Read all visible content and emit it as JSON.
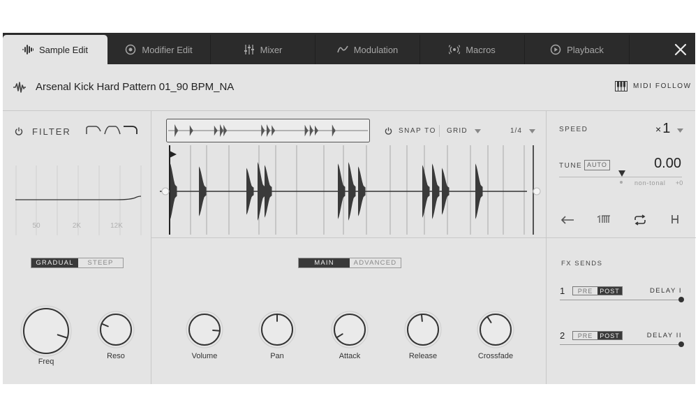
{
  "tabs": [
    {
      "label": "Sample Edit",
      "icon": "waveform-icon",
      "active": true
    },
    {
      "label": "Modifier Edit",
      "icon": "target-icon",
      "active": false
    },
    {
      "label": "Mixer",
      "icon": "mixer-faders-icon",
      "active": false
    },
    {
      "label": "Modulation",
      "icon": "wave-curve-icon",
      "active": false
    },
    {
      "label": "Macros",
      "icon": "broadcast-icon",
      "active": false
    },
    {
      "label": "Playback",
      "icon": "play-circle-icon",
      "active": false
    }
  ],
  "header": {
    "sample_name": "Arsenal Kick Hard Pattern 01_90 BPM_NA",
    "midi_follow": "MIDI FOLLOW"
  },
  "filter": {
    "title": "FILTER",
    "freq_ticks": [
      "50",
      "2K",
      "12K"
    ],
    "modes": [
      "GRADUAL",
      "STEEP"
    ],
    "mode_selected": "GRADUAL",
    "knobs": [
      {
        "label": "Freq",
        "value": 0.9
      },
      {
        "label": "Reso",
        "value": 0.25
      }
    ]
  },
  "waveform": {
    "snap_label": "SNAP TO",
    "grid_label": "GRID",
    "division": "1/4",
    "tabs": [
      "MAIN",
      "ADVANCED"
    ],
    "tab_selected": "MAIN",
    "knobs": [
      {
        "label": "Volume",
        "value": 0.85
      },
      {
        "label": "Pan",
        "value": 0.5
      },
      {
        "label": "Attack",
        "value": 0.05
      },
      {
        "label": "Release",
        "value": 0.48
      },
      {
        "label": "Crossfade",
        "value": 0.38
      }
    ]
  },
  "speed": {
    "label": "SPEED",
    "prefix": "×",
    "value": "1"
  },
  "tune": {
    "label": "TUNE",
    "auto": "AUTO",
    "value": "0.00",
    "nontonal": "non-tonal",
    "offset": "+0"
  },
  "fx": {
    "title": "FX SENDS",
    "sends": [
      {
        "num": "1",
        "pre": "PRE",
        "post": "POST",
        "name": "DELAY I",
        "level": 1.0
      },
      {
        "num": "2",
        "pre": "PRE",
        "post": "POST",
        "name": "DELAY II",
        "level": 1.0
      }
    ]
  }
}
